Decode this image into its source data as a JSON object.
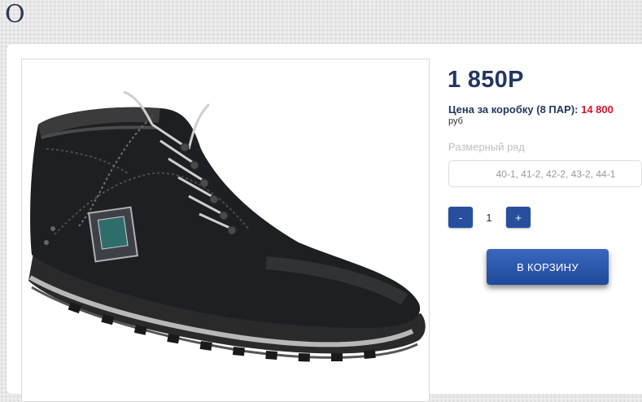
{
  "header": {
    "title": "О"
  },
  "product": {
    "image": {
      "icon": "product-boot-image"
    },
    "price": "1 850Р",
    "box_price_label": "Цена за коробку (8 ПАР):",
    "box_price_value": "14 800",
    "currency": "руб",
    "size_label": "Размерный ряд",
    "size_value": "40-1, 41-2, 42-2, 43-2, 44-1",
    "quantity": {
      "minus_label": "-",
      "value": "1",
      "plus_label": "+"
    },
    "cart_button_label": "В КОРЗИНУ"
  },
  "colors": {
    "accent": "#274f9d",
    "price_text": "#233760",
    "box_price": "#d0172b"
  }
}
